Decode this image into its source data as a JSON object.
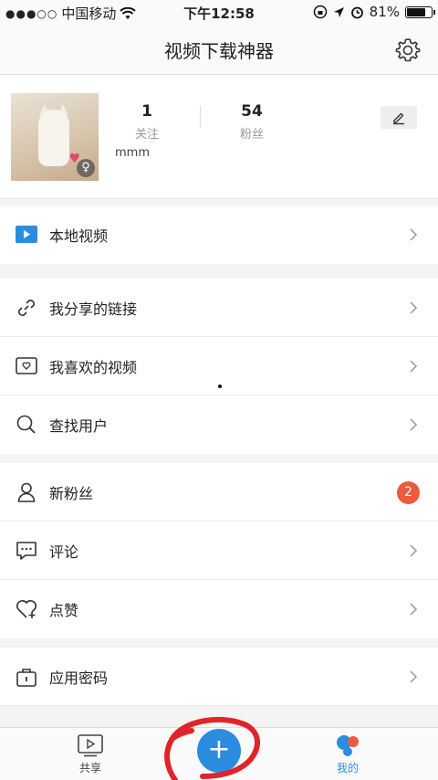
{
  "status_bar": {
    "carrier": "中国移动",
    "time": "下午12:58",
    "battery": "81%",
    "battery_level": 0.81
  },
  "nav": {
    "title": "视频下载神器",
    "settings_icon": "gear-icon"
  },
  "profile": {
    "following_count": "1",
    "following_label": "关注",
    "fans_count": "54",
    "fans_label": "粉丝",
    "username": "mmm",
    "gender_icon": "female-icon",
    "edit_icon": "pencil-icon"
  },
  "menu": [
    {
      "label": "本地视频",
      "icon": "play-video-icon"
    },
    {
      "label": "我分享的链接",
      "icon": "link-icon"
    },
    {
      "label": "我喜欢的视频",
      "icon": "heart-tv-icon"
    },
    {
      "label": "查找用户",
      "icon": "search-icon"
    },
    {
      "label": "新粉丝",
      "icon": "user-icon",
      "badge": "2"
    },
    {
      "label": "评论",
      "icon": "comment-icon"
    },
    {
      "label": "点赞",
      "icon": "like-icon"
    },
    {
      "label": "应用密码",
      "icon": "lock-icon"
    }
  ],
  "tab_bar": {
    "share_label": "共享",
    "mine_label": "我的",
    "plus_symbol": "+"
  },
  "colors": {
    "accent_blue": "#2b8de0",
    "badge_red": "#ee5a3c",
    "annotation_red": "#e0242a"
  }
}
